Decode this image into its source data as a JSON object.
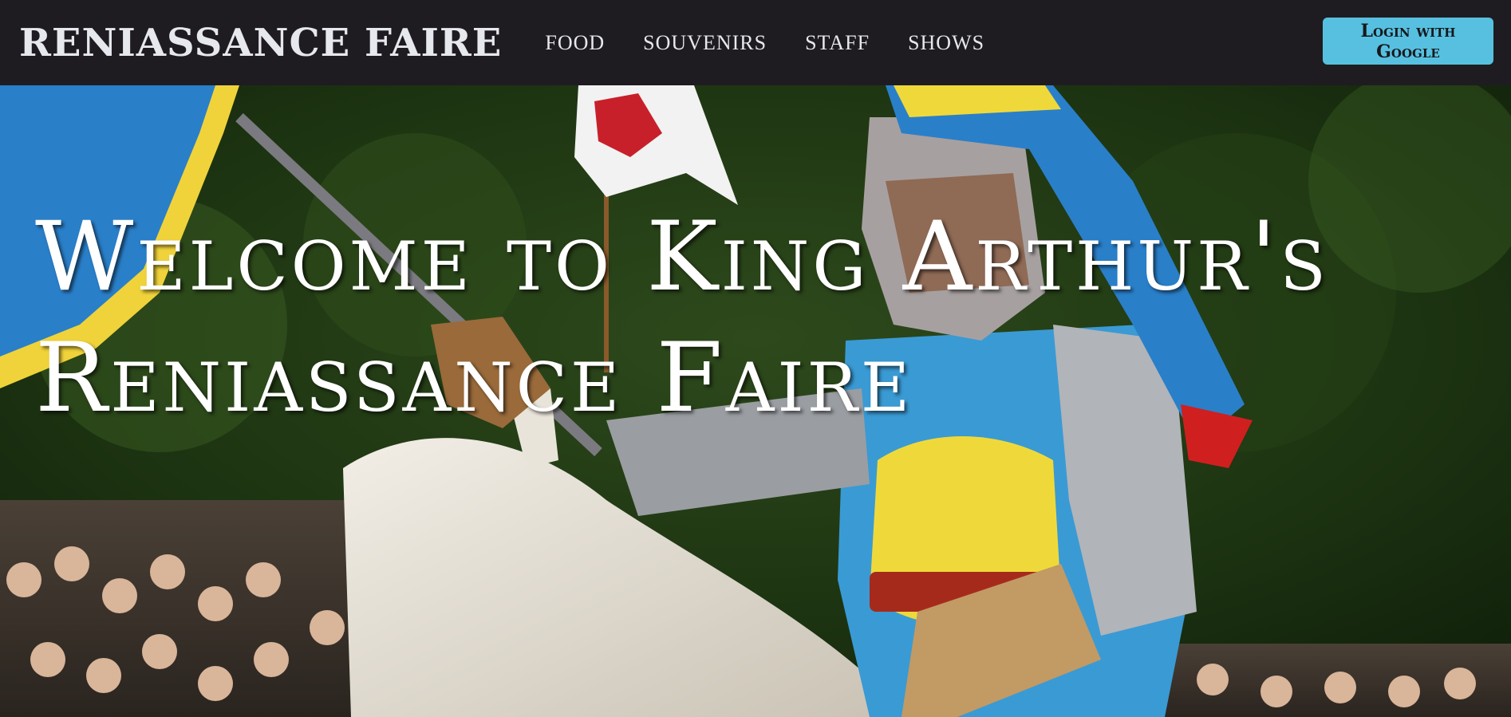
{
  "brand": {
    "title": "RENIASSANCE FAIRE"
  },
  "nav": {
    "items": [
      {
        "label": "FOOD"
      },
      {
        "label": "SOUVENIRS"
      },
      {
        "label": "STAFF"
      },
      {
        "label": "SHOWS"
      }
    ]
  },
  "login": {
    "label": "Login with Google"
  },
  "hero": {
    "title": "Welcome to King Arthur's Reniassance Faire",
    "image": "knight-on-horse-photo"
  },
  "colors": {
    "navbar_bg": "#1e1c21",
    "nav_text": "#e6e8ee",
    "button_bg": "#57c0e0",
    "hero_text": "#ffffff"
  }
}
